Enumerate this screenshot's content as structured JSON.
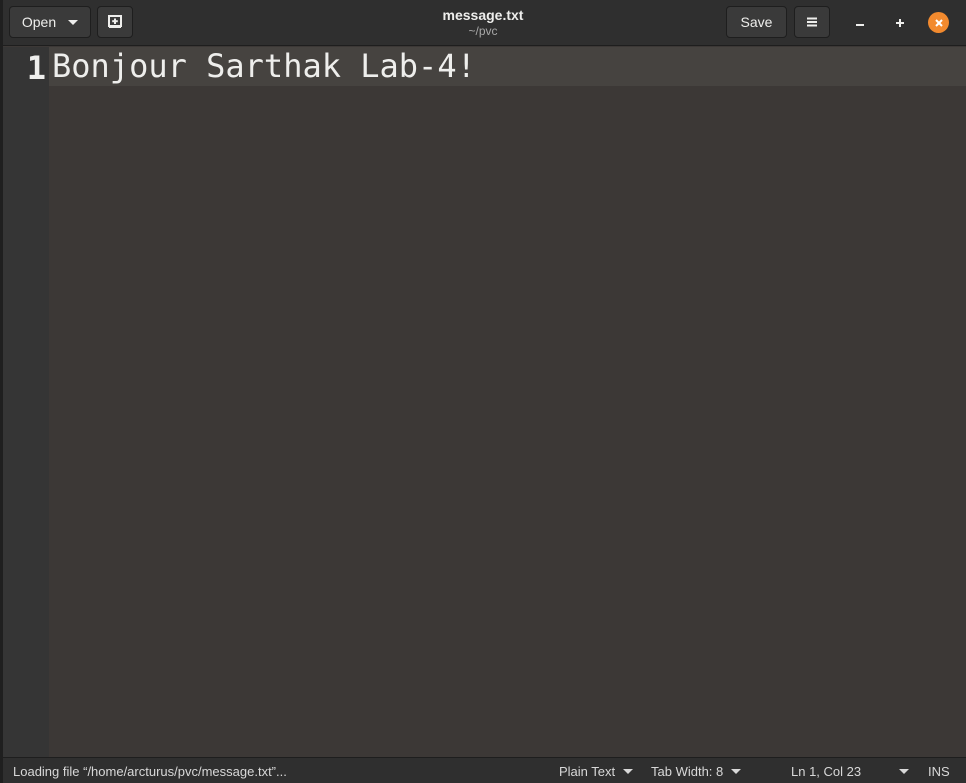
{
  "header": {
    "open_label": "Open",
    "save_label": "Save",
    "title": "message.txt",
    "subtitle": "~/pvc"
  },
  "icons": {
    "new_tab": "new-document-icon",
    "menu": "hamburger-menu-icon",
    "minimize": "minimize-icon",
    "maximize": "maximize-icon",
    "close": "close-icon"
  },
  "editor": {
    "lines": [
      {
        "number": "1",
        "text": "Bonjour Sarthak Lab-4!"
      }
    ]
  },
  "statusbar": {
    "message": "Loading file “/home/arcturus/pvc/message.txt”...",
    "language": "Plain Text",
    "tab_width": "Tab Width: 8",
    "position": "Ln 1, Col 23",
    "mode": "INS"
  },
  "colors": {
    "close_button": "#f28a2e",
    "editor_bg": "#3c3836",
    "headerbar_bg": "#2f2f2f"
  }
}
